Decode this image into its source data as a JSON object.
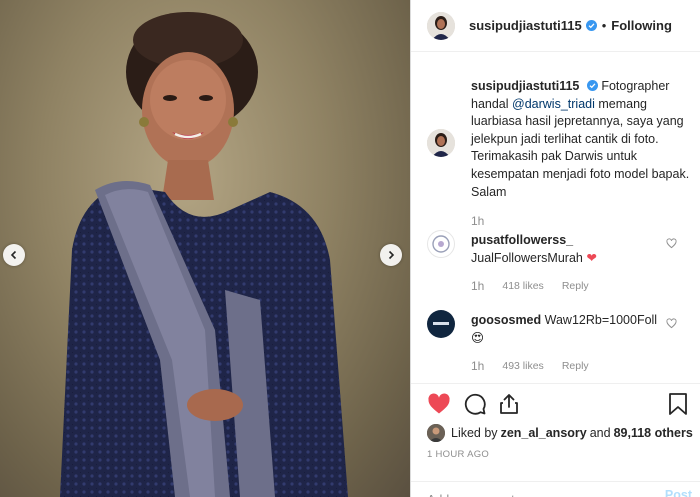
{
  "header": {
    "username": "susipudjiastuti115",
    "separator": "•",
    "follow_status": "Following"
  },
  "caption": {
    "username": "susipudjiastuti115",
    "text_before": " Fotographer handal ",
    "mention": "@darwis_triadi",
    "text_after": " memang luarbiasa hasil jepretannya, saya yang jelekpun jadi terlihat cantik di foto. Terimakasih pak Darwis untuk kesempatan menjadi foto model bapak. Salam",
    "time": "1h"
  },
  "comments": [
    {
      "username": "pusatfollowerss_",
      "text": "JualFollowersMurah",
      "emoji": "❤",
      "time": "1h",
      "likes": "418 likes",
      "reply": "Reply"
    },
    {
      "username": "goososmed",
      "text": "Waw12Rb=1000Foll",
      "emoji": "😍",
      "time": "1h",
      "likes": "493 likes",
      "reply": "Reply"
    }
  ],
  "likes": {
    "prefix": "Liked by ",
    "user": "zen_al_ansory",
    "middle": " and ",
    "count": "89,118 others"
  },
  "timestamp": "1 HOUR AGO",
  "add_comment": {
    "placeholder": "Add a comment...",
    "post_label": "Post"
  },
  "colors": {
    "heart_red": "#ed4956",
    "verified_blue": "#3897f0",
    "post_disabled": "#b2dffc",
    "mention": "#00376b",
    "muted": "#8e8e8e"
  },
  "icons": [
    "chevron-left-icon",
    "chevron-right-icon",
    "verified-badge-icon",
    "heart-icon",
    "comment-icon",
    "share-icon",
    "bookmark-icon",
    "heart-outline-icon"
  ]
}
